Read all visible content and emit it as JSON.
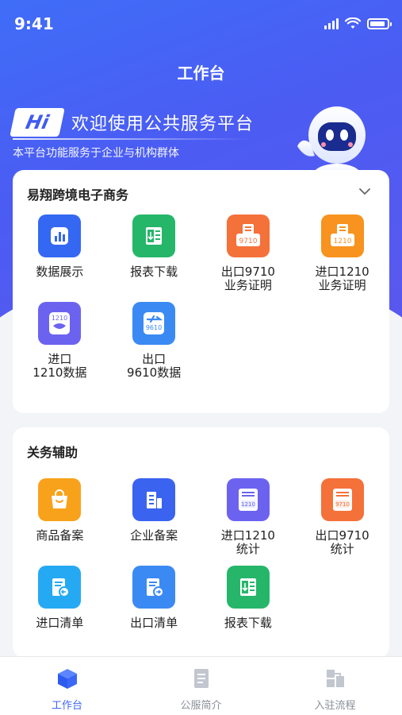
{
  "status": {
    "time": "9:41"
  },
  "header": {
    "title": "工作台"
  },
  "welcome": {
    "badge": "Hi",
    "title": "欢迎使用公共服务平台",
    "subtitle": "本平台功能服务于企业与机构群体"
  },
  "sections": [
    {
      "title": "易翔跨境电子商务",
      "items": [
        {
          "label": "数据展示",
          "icon": "chart-icon",
          "color": "#3568f2"
        },
        {
          "label": "报表下载",
          "icon": "report-download-icon",
          "color": "#25b66a"
        },
        {
          "label": "出口9710\n业务证明",
          "icon": "export-9710-certificate-icon",
          "color": "#f4713a",
          "tag": "9710"
        },
        {
          "label": "进口1210\n业务证明",
          "icon": "import-1210-certificate-icon",
          "color": "#f7931e",
          "tag": "1210"
        },
        {
          "label": "进口\n1210数据",
          "icon": "import-1210-data-icon",
          "color": "#6b63f0",
          "tag": "1210"
        },
        {
          "label": "出口\n9610数据",
          "icon": "export-9610-data-icon",
          "color": "#3b8af3",
          "tag": "9610"
        }
      ]
    },
    {
      "title": "关务辅助",
      "items": [
        {
          "label": "商品备案",
          "icon": "shopping-bag-icon",
          "color": "#f8a21b"
        },
        {
          "label": "企业备案",
          "icon": "building-icon",
          "color": "#3a63f0"
        },
        {
          "label": "进口1210\n统计",
          "icon": "import-1210-stats-icon",
          "color": "#6b63f0",
          "tag": "1210"
        },
        {
          "label": "出口9710\n统计",
          "icon": "export-9710-stats-icon",
          "color": "#f4713a",
          "tag": "9710"
        },
        {
          "label": "进口清单",
          "icon": "import-list-icon",
          "color": "#26a9f3"
        },
        {
          "label": "出口清单",
          "icon": "export-list-icon",
          "color": "#3b8af3"
        },
        {
          "label": "报表下载",
          "icon": "report-download-icon",
          "color": "#25b66a"
        }
      ]
    }
  ],
  "tabbar": {
    "items": [
      {
        "label": "工作台",
        "icon": "workbench-cube-icon",
        "active": true
      },
      {
        "label": "公服简介",
        "icon": "document-icon",
        "active": false
      },
      {
        "label": "入驻流程",
        "icon": "process-icon",
        "active": false
      }
    ]
  }
}
